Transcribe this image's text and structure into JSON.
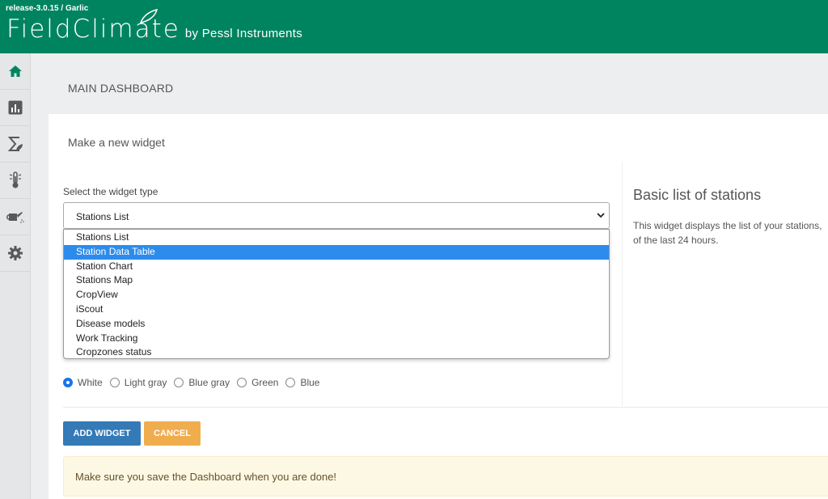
{
  "header": {
    "release": "release-3.0.15 / Garlic",
    "logo_main": "FieldClimate",
    "logo_by": "by Pessl Instruments"
  },
  "sidebar": {
    "items": [
      {
        "icon": "home-icon"
      },
      {
        "icon": "bar-chart-icon"
      },
      {
        "icon": "sigma-leaf-icon"
      },
      {
        "icon": "thermometer-icon"
      },
      {
        "icon": "watering-can-icon"
      },
      {
        "icon": "gear-icon"
      }
    ]
  },
  "page": {
    "title": "MAIN DASHBOARD"
  },
  "widget_form": {
    "title": "Make a new widget",
    "type_label": "Select the widget type",
    "selected": "Stations List",
    "options": [
      "Stations List",
      "Station Data Table",
      "Station Chart",
      "Stations Map",
      "CropView",
      "iScout",
      "Disease models",
      "Work Tracking",
      "Cropzones status"
    ],
    "highlighted_option": "Station Data Table",
    "colors": [
      "White",
      "Light gray",
      "Blue gray",
      "Green",
      "Blue"
    ],
    "selected_color": "White",
    "add_label": "ADD WIDGET",
    "cancel_label": "CANCEL"
  },
  "preview": {
    "title": "Basic list of stations",
    "desc_line1": "This widget displays the list of your stations,",
    "desc_line2": "of the last 24 hours."
  },
  "alert": {
    "text": "Make sure you save the Dashboard when you are done!"
  },
  "colors": {
    "brand": "#00845f",
    "primary": "#337ab7",
    "warning": "#f0ad4e",
    "highlight": "#2d8ceb"
  }
}
